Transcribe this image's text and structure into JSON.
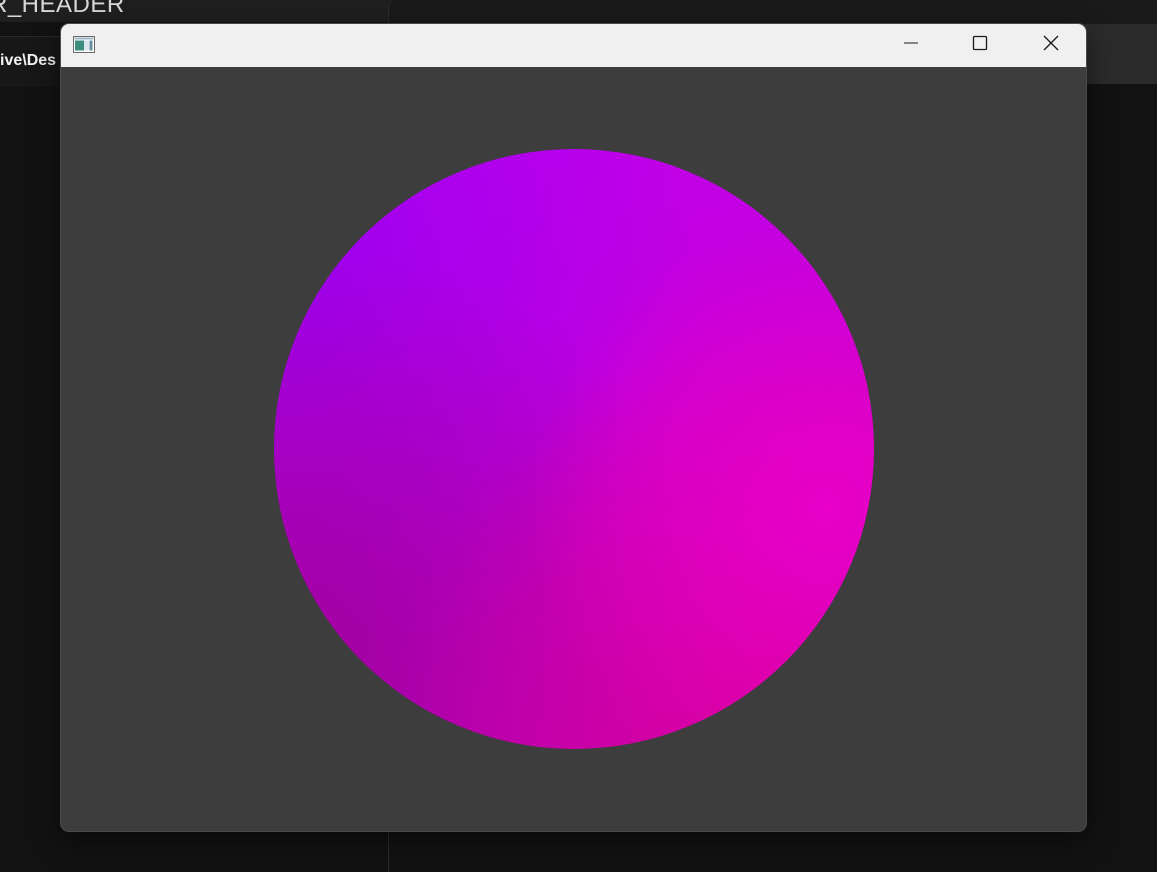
{
  "background": {
    "header_text": "R_HEADER",
    "path_text": "ive\\Des"
  },
  "window": {
    "title": "",
    "controls": {
      "minimize": "minimize",
      "maximize": "maximize",
      "close": "close"
    },
    "client_background": "#3d3d3d"
  },
  "render": {
    "shape": "circle",
    "gradient_colors": {
      "top_left": "#9a00f0",
      "top": "#c000f0",
      "right": "#e800c8",
      "bottom_left": "#a000a0",
      "bottom_right": "#d80098"
    }
  }
}
